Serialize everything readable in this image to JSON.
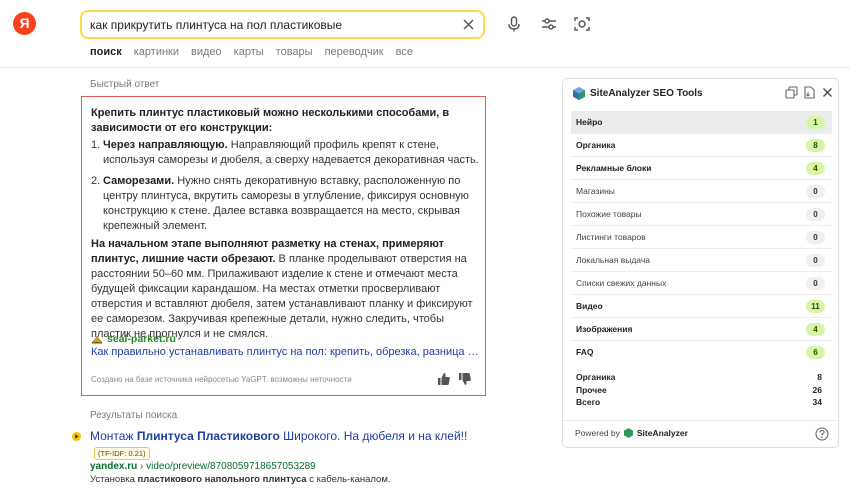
{
  "logo": {
    "letter": "Я"
  },
  "search": {
    "query": "как прикрутить плинтуса на пол пластиковые"
  },
  "tabs": [
    "поиск",
    "картинки",
    "видео",
    "карты",
    "товары",
    "переводчик",
    "все"
  ],
  "quick_answer": {
    "label": "Быстрый ответ",
    "intro": "Крепить плинтус пластиковый можно несколькими способами, в зависимости от его конструкции:",
    "items": [
      {
        "num": "1.",
        "title": "Через направляющую.",
        "text": " Направляющий профиль крепят к стене, используя саморезы и дюбеля, а сверху надевается декоративная часть."
      },
      {
        "num": "2.",
        "title": "Саморезами.",
        "text": " Нужно снять декоративную вставку, расположенную по центру плинтуса, вкрутить саморезы в углубление, фиксируя основную конструкцию к стене. Далее вставка возвращается на место, скрывая крепежный элемент."
      }
    ],
    "para_bold": "На начальном этапе выполняют разметку на стенах, примеряют плинтус, лишние части обрезают.",
    "para_text": " В планке проделывают отверстия на расстоянии 50–60 мм. Прилаживают изделие к стене и отмечают места будущей фиксации карандашом. На местах отметки просверливают отверстия и вставляют дюбеля, затем устанавливают планку и фиксируют ее саморезом. Закручивая крепежные детали, нужно следить, чтобы пластик не прогнулся и не смялся.",
    "source_domain": "seal-parket.ru",
    "source_title": "Как правильно устанавливать плинтус на пол: крепить, обрезка, разница мате…",
    "note": "Создано на базе источника нейросетью YaGPT, возможны неточности"
  },
  "results": {
    "label": "Результаты поиска",
    "title_pre": "Монтаж ",
    "title_bold": "Плинтуса Пластикового",
    "title_post": " Широкого. На дюбеля и на клей!!",
    "tfidf": "(TF-IDF: 0.21)",
    "url_domain": "yandex.ru",
    "url_path": " › video/preview/8708059718657053289",
    "snippet_pre": "Установка ",
    "snippet_bold": "пластикового напольного плинтуса",
    "snippet_post": " с кабель-каналом."
  },
  "seo_panel": {
    "title": "SiteAnalyzer SEO Tools",
    "rows": [
      {
        "label": "Нейро",
        "value": "1",
        "bold": true,
        "green": true
      },
      {
        "label": "Органика",
        "value": "8",
        "bold": true,
        "green": true
      },
      {
        "label": "Рекламные блоки",
        "value": "4",
        "bold": true,
        "green": true
      },
      {
        "label": "Магазины",
        "value": "0",
        "bold": false,
        "green": false
      },
      {
        "label": "Похожие товары",
        "value": "0",
        "bold": false,
        "green": false
      },
      {
        "label": "Листинги товаров",
        "value": "0",
        "bold": false,
        "green": false
      },
      {
        "label": "Локальная выдача",
        "value": "0",
        "bold": false,
        "green": false
      },
      {
        "label": "Списки свежих данных",
        "value": "0",
        "bold": false,
        "green": false
      },
      {
        "label": "Видео",
        "value": "11",
        "bold": true,
        "green": true
      },
      {
        "label": "Изображения",
        "value": "4",
        "bold": true,
        "green": true
      },
      {
        "label": "FAQ",
        "value": "6",
        "bold": true,
        "green": true
      }
    ],
    "totals": [
      {
        "label": "Органика",
        "value": "8"
      },
      {
        "label": "Прочее",
        "value": "26"
      },
      {
        "label": "Всего",
        "value": "34"
      }
    ],
    "powered_by": "Powered by",
    "brand": "SiteAnalyzer"
  }
}
